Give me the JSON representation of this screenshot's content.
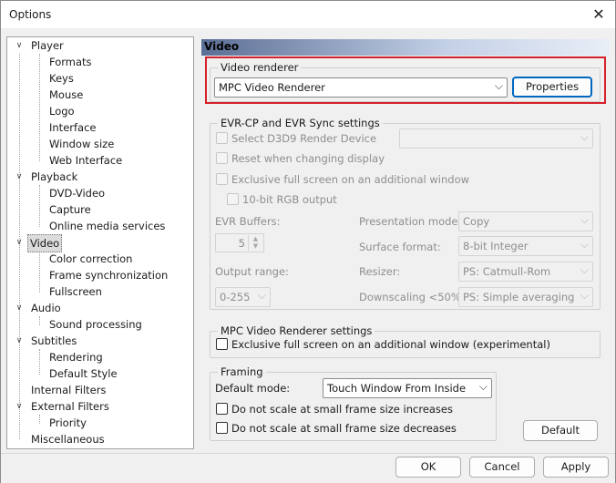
{
  "window": {
    "title": "Options",
    "close_glyph": "✕"
  },
  "tree": {
    "items": [
      {
        "label": "Player",
        "toggle": "∨"
      },
      {
        "label": "Formats"
      },
      {
        "label": "Keys"
      },
      {
        "label": "Mouse"
      },
      {
        "label": "Logo"
      },
      {
        "label": "Interface"
      },
      {
        "label": "Window size"
      },
      {
        "label": "Web Interface"
      },
      {
        "label": "Playback",
        "toggle": "∨"
      },
      {
        "label": "DVD-Video"
      },
      {
        "label": "Capture"
      },
      {
        "label": "Online media services"
      },
      {
        "label": "Video",
        "toggle": "∨"
      },
      {
        "label": "Color correction"
      },
      {
        "label": "Frame synchronization"
      },
      {
        "label": "Fullscreen"
      },
      {
        "label": "Audio",
        "toggle": "∨"
      },
      {
        "label": "Sound processing"
      },
      {
        "label": "Subtitles",
        "toggle": "∨"
      },
      {
        "label": "Rendering"
      },
      {
        "label": "Default Style"
      },
      {
        "label": "Internal Filters"
      },
      {
        "label": "External Filters",
        "toggle": "∨"
      },
      {
        "label": "Priority"
      },
      {
        "label": "Miscellaneous"
      }
    ]
  },
  "panel": {
    "header": "Video",
    "video_renderer": {
      "legend": "Video renderer",
      "selected": "MPC Video Renderer",
      "properties_label": "Properties"
    },
    "evr": {
      "legend": "EVR-CP and EVR Sync settings",
      "select_d3d9": "Select D3D9 Render Device",
      "reset_on_change": "Reset when changing display",
      "exclusive_fullscreen": "Exclusive full screen on an additional window",
      "rgb10": "10-bit RGB output",
      "buffers_label": "EVR Buffers:",
      "buffers_value": "5",
      "output_range_label": "Output range:",
      "output_range_value": "0-255",
      "presentation_mode_label": "Presentation mode:",
      "presentation_mode_value": "Copy",
      "surface_format_label": "Surface format:",
      "surface_format_value": "8-bit Integer",
      "resizer_label": "Resizer:",
      "resizer_value": "PS: Catmull-Rom",
      "downscaling_label": "Downscaling <50%:",
      "downscaling_value": "PS: Simple averaging"
    },
    "mpc_vr": {
      "legend": "MPC Video Renderer settings",
      "exclusive_fullscreen": "Exclusive full screen on an additional window (experimental)"
    },
    "framing": {
      "legend": "Framing",
      "default_mode_label": "Default mode:",
      "default_mode_value": "Touch Window From Inside",
      "no_scale_increase": "Do not scale at small frame size increases",
      "no_scale_decrease": "Do not scale at small frame size decreases"
    },
    "default_button": "Default"
  },
  "footer": {
    "ok": "OK",
    "cancel": "Cancel",
    "apply": "Apply"
  },
  "colors": {
    "highlight": "#d6202a",
    "header_gradient_start": "#5b6e95",
    "primary_border": "#0067c0"
  },
  "icons": {
    "dropdown": "⌵",
    "spin_up": "▲",
    "spin_down": "▼"
  }
}
